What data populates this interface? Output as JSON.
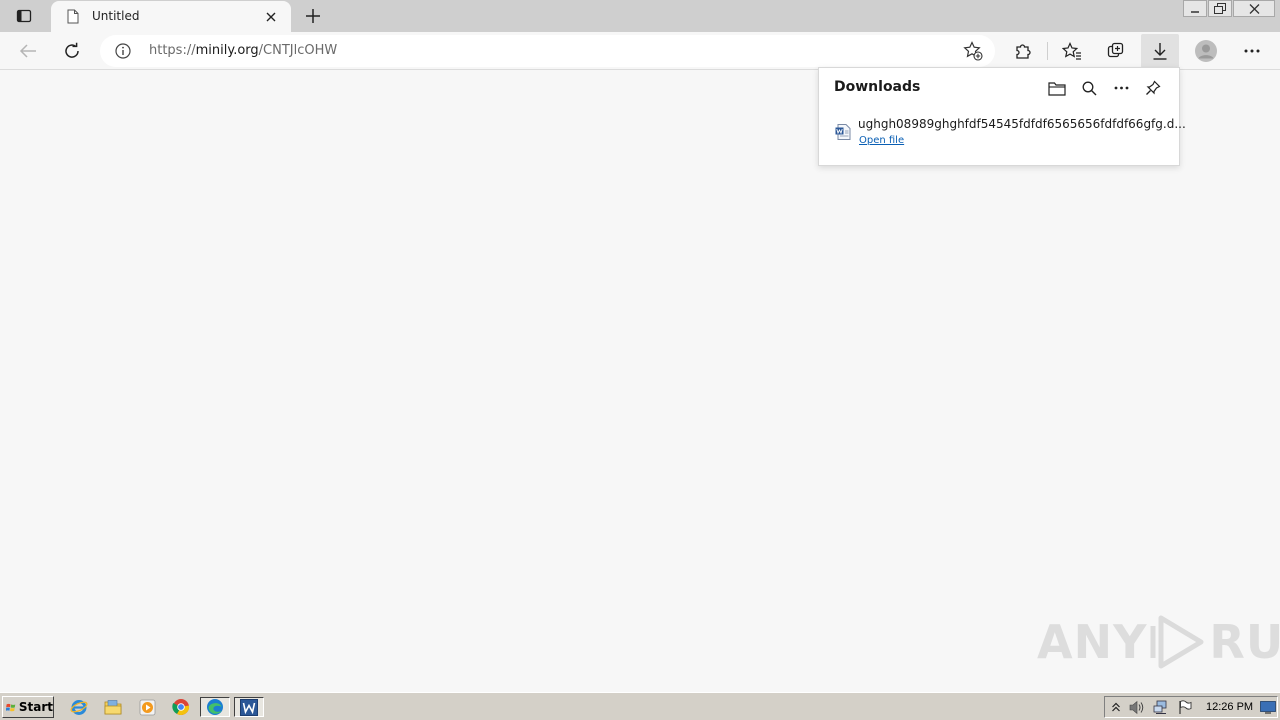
{
  "tab": {
    "title": "Untitled"
  },
  "address": {
    "prefix": "https://",
    "domain": "minily.org",
    "path": "/CNTJlcOHW"
  },
  "downloads": {
    "heading": "Downloads",
    "items": [
      {
        "filename": "ughgh08989ghghfdf54545fdfdf6565656fdfdf66gfg.d...",
        "action": "Open file"
      }
    ]
  },
  "watermark": {
    "left": "ANY",
    "right": "RUN"
  },
  "taskbar": {
    "start_label": "Start",
    "clock": "12:26 PM"
  },
  "colors": {
    "tabstrip_bg": "#cfcfcf",
    "page_bg": "#f7f7f7",
    "link": "#0a5fb4",
    "taskbar_bg": "#d4d0c8"
  }
}
